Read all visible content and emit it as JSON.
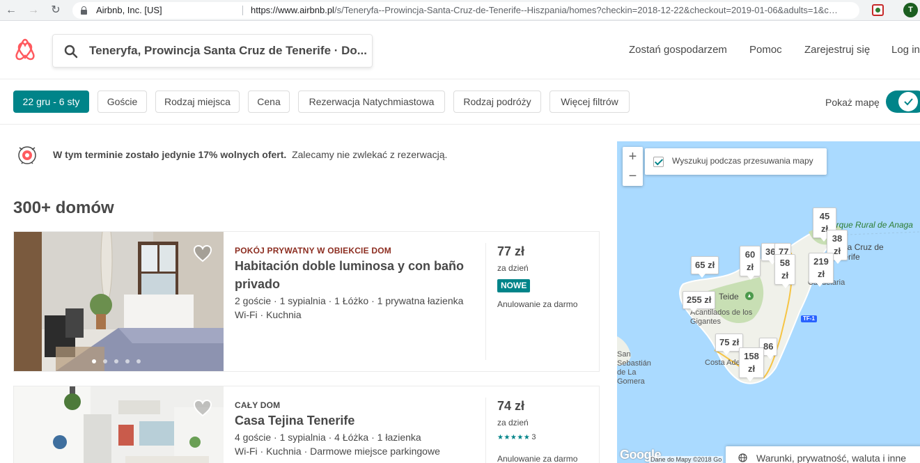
{
  "browser": {
    "site_name": "Airbnb, Inc. [US]",
    "url_host": "https://www.airbnb.pl",
    "url_path": "/s/Teneryfa--Prowincja-Santa-Cruz-de-Tenerife--Hiszpania/homes?checkin=2018-12-22&checkout=2019-01-06&adults=1&chil...",
    "profile_initial": "T"
  },
  "header": {
    "search_value": "Teneryfa, Prowincja Santa Cruz de Tenerife · Do...",
    "links": [
      "Zostań gospodarzem",
      "Pomoc",
      "Zarejestruj się",
      "Log in"
    ]
  },
  "filters": {
    "dates": "22 gru - 6 sty",
    "items": [
      "Goście",
      "Rodzaj miejsca",
      "Cena",
      "Rezerwacja Natychmiastowa",
      "Rodzaj podróży",
      "Więcej filtrów"
    ],
    "show_map_label": "Pokaż mapę",
    "show_map_on": true
  },
  "notice": {
    "bold": "W tym terminie zostało jedynie 17% wolnych ofert.",
    "text": "Zalecamy nie zwlekać z rezerwacją."
  },
  "results": {
    "count_label": "300+ domów",
    "listings": [
      {
        "kind": "POKÓJ PRYWATNY W OBIEKCIE DOM",
        "title": "Habitación doble luminosa y con baño privado",
        "details_1": "2 goście · 1 sypialnia · 1 Łóżko · 1 prywatna łazienka",
        "details_2": "Wi-Fi · Kuchnia",
        "price": "77 zł",
        "per": "za dzień",
        "badge": "NOWE",
        "cancellation": "Anulowanie za darmo",
        "photo_dots": 5,
        "photo_index": 0
      },
      {
        "kind": "CAŁY DOM",
        "title": "Casa Tejina Tenerife",
        "details_1": "4 goście · 1 sypialnia · 4 Łóżka · 1 łazienka",
        "details_2": "Wi-Fi · Kuchnia · Darmowe miejsce parkingowe",
        "price": "74 zł",
        "per": "za dzień",
        "rating_stars": "★★★★★",
        "rating_count": "3",
        "cancellation": "Anulowanie za darmo"
      }
    ]
  },
  "map": {
    "search_while_moving": "Wyszukuj podczas przesuwania mapy",
    "zoom_in": "+",
    "zoom_out": "−",
    "markers": [
      "45 zł",
      "38 zł",
      "60 zł",
      "36",
      "77",
      "58 zł",
      "219 zł",
      "65 zł",
      "255 zł",
      "75 zł",
      "86",
      "158 zł"
    ],
    "labels": {
      "park": "Parque Rural de Anaga",
      "santa_cruz": "Santa Cruz de Tenerife",
      "candelaria": "Candelaria",
      "teide": "Teide",
      "acantilados": "Acantilados de los Gigantes",
      "san_sebastian": "San Sebastián de La Gomera",
      "costa_adeje": "Costa Adeje",
      "road": "TF-1"
    },
    "google": "Google",
    "copyright": "Dane do Mapy ©2018 Go",
    "terms": "Warunki, prywatność, waluta i inne"
  }
}
